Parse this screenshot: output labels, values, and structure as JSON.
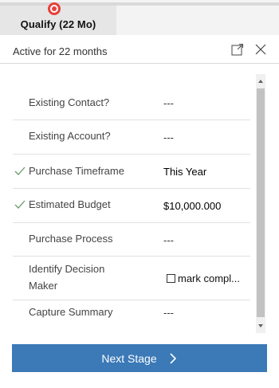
{
  "stage": {
    "label": "Qualify  (22 Mo)",
    "colors": {
      "active_dot": "#e8403a",
      "tab_bg": "#e6e6e6"
    }
  },
  "flyout": {
    "active_text": "Active for 22 months",
    "popout_icon": "popout-icon",
    "close_icon": "close-icon"
  },
  "fields": [
    {
      "label": "Existing Contact?",
      "value": "---",
      "completed": false
    },
    {
      "label": "Existing Account?",
      "value": "---",
      "completed": false
    },
    {
      "label": "Purchase Timeframe",
      "value": "This Year",
      "completed": true
    },
    {
      "label": "Estimated Budget",
      "value": "$10,000.000",
      "completed": true
    },
    {
      "label": "Purchase Process",
      "value": "---",
      "completed": false
    },
    {
      "label_line1": "Identify Decision",
      "label_line2": "Maker",
      "checkbox_label": "mark compl...",
      "checked": false
    },
    {
      "label": "Capture Summary",
      "value": "---",
      "completed": false
    }
  ],
  "next_button": {
    "label": "Next Stage",
    "color": "#3b79b7",
    "icon": "chevron-right-icon"
  }
}
